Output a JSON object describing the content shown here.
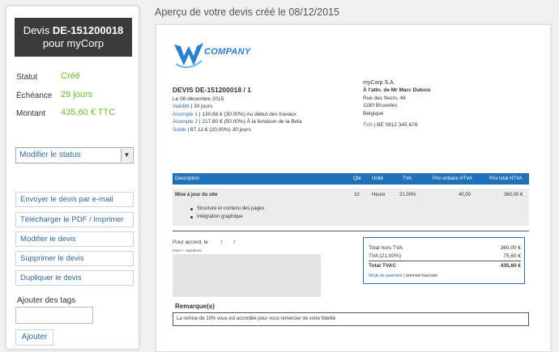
{
  "sidebar": {
    "header_prefix": "Devis",
    "header_number": "DE-151200018",
    "header_sub": "pour myCorp",
    "statut_label": "Statut",
    "statut_value": "Créé",
    "echeance_label": "Échéance",
    "echeance_value": "29 jours",
    "montant_label": "Montant",
    "montant_value": "435,60 € TTC",
    "status_select_value": "Modifier le status",
    "actions": [
      "Envoyer le devis par e-mail",
      "Télécharger le PDF / Imprimer",
      "Modifier le devis",
      "Supprimer le devis",
      "Dupliquer le devis"
    ],
    "tags_label": "Ajouter des tags",
    "tags_input_value": "",
    "add_button": "Ajouter"
  },
  "main": {
    "title": "Aperçu de votre devis créé le 08/12/2015"
  },
  "document": {
    "logo_text": "COMPANY",
    "quote_title": "DEVIS DE-151200018 / 1",
    "date_line": "Le 08 décembre 2015",
    "validite_label": "Validité",
    "validite_value": " | 30 jours",
    "acompte1_label": "Acompte 1",
    "acompte1_value": " | 130,68 € (30.00%) Au début des travaux",
    "acompte2_label": "Acompte 2",
    "acompte2_value": " | 217,80 € (50.00%) À la livraison de la Beta",
    "solde_label": "Solde",
    "solde_value": " | 87,12 € (20.00%) 30 jours",
    "client_name": "myCorp S.A.",
    "client_attn": "À l'attn. de Mr Marc Dubois",
    "client_street": "Rue des fleurs, 46",
    "client_city": "1180 Bruxelles",
    "client_country": "Belgique",
    "tva_label": "TVA",
    "tva_value": " | BE 0812 345 678",
    "table": {
      "headers": [
        "Description",
        "Qté",
        "Unité",
        "TVA",
        "Prix unitaire HTVA",
        "Prix total HTVA"
      ],
      "row": {
        "description": "Mise à jour du site",
        "qty": "10",
        "unit": "Heure",
        "tva": "21.00%",
        "unit_price": "40,00",
        "total": "360,00 €",
        "bullets": [
          "Structure et contenu des pages",
          "Intégration graphique"
        ]
      }
    },
    "accord_label": "Pour accord, le",
    "accord_slash1": "/",
    "accord_slash2": "/",
    "accord_sub": "(Nom + signature)",
    "totals": {
      "total_htva_label": "Total hors TVA",
      "total_htva_value": "360,00 €",
      "tva_label": "TVA (21.00%)",
      "tva_value": "75,60 €",
      "total_tvac_label": "Total TVAC",
      "total_tvac_value": "435,60 €",
      "payment_label": "Mode de paiement",
      "payment_value": " | virement bancaire"
    },
    "remark_title": "Remarque(s)",
    "remark_text": "La remise de 10% vous est accordée pour vous remercier de votre fidelité"
  },
  "colors": {
    "accent_blue": "#1f72b8",
    "link_blue": "#2e6aa8",
    "status_green": "#6bbf2a",
    "header_dark": "#3b3b3b"
  }
}
